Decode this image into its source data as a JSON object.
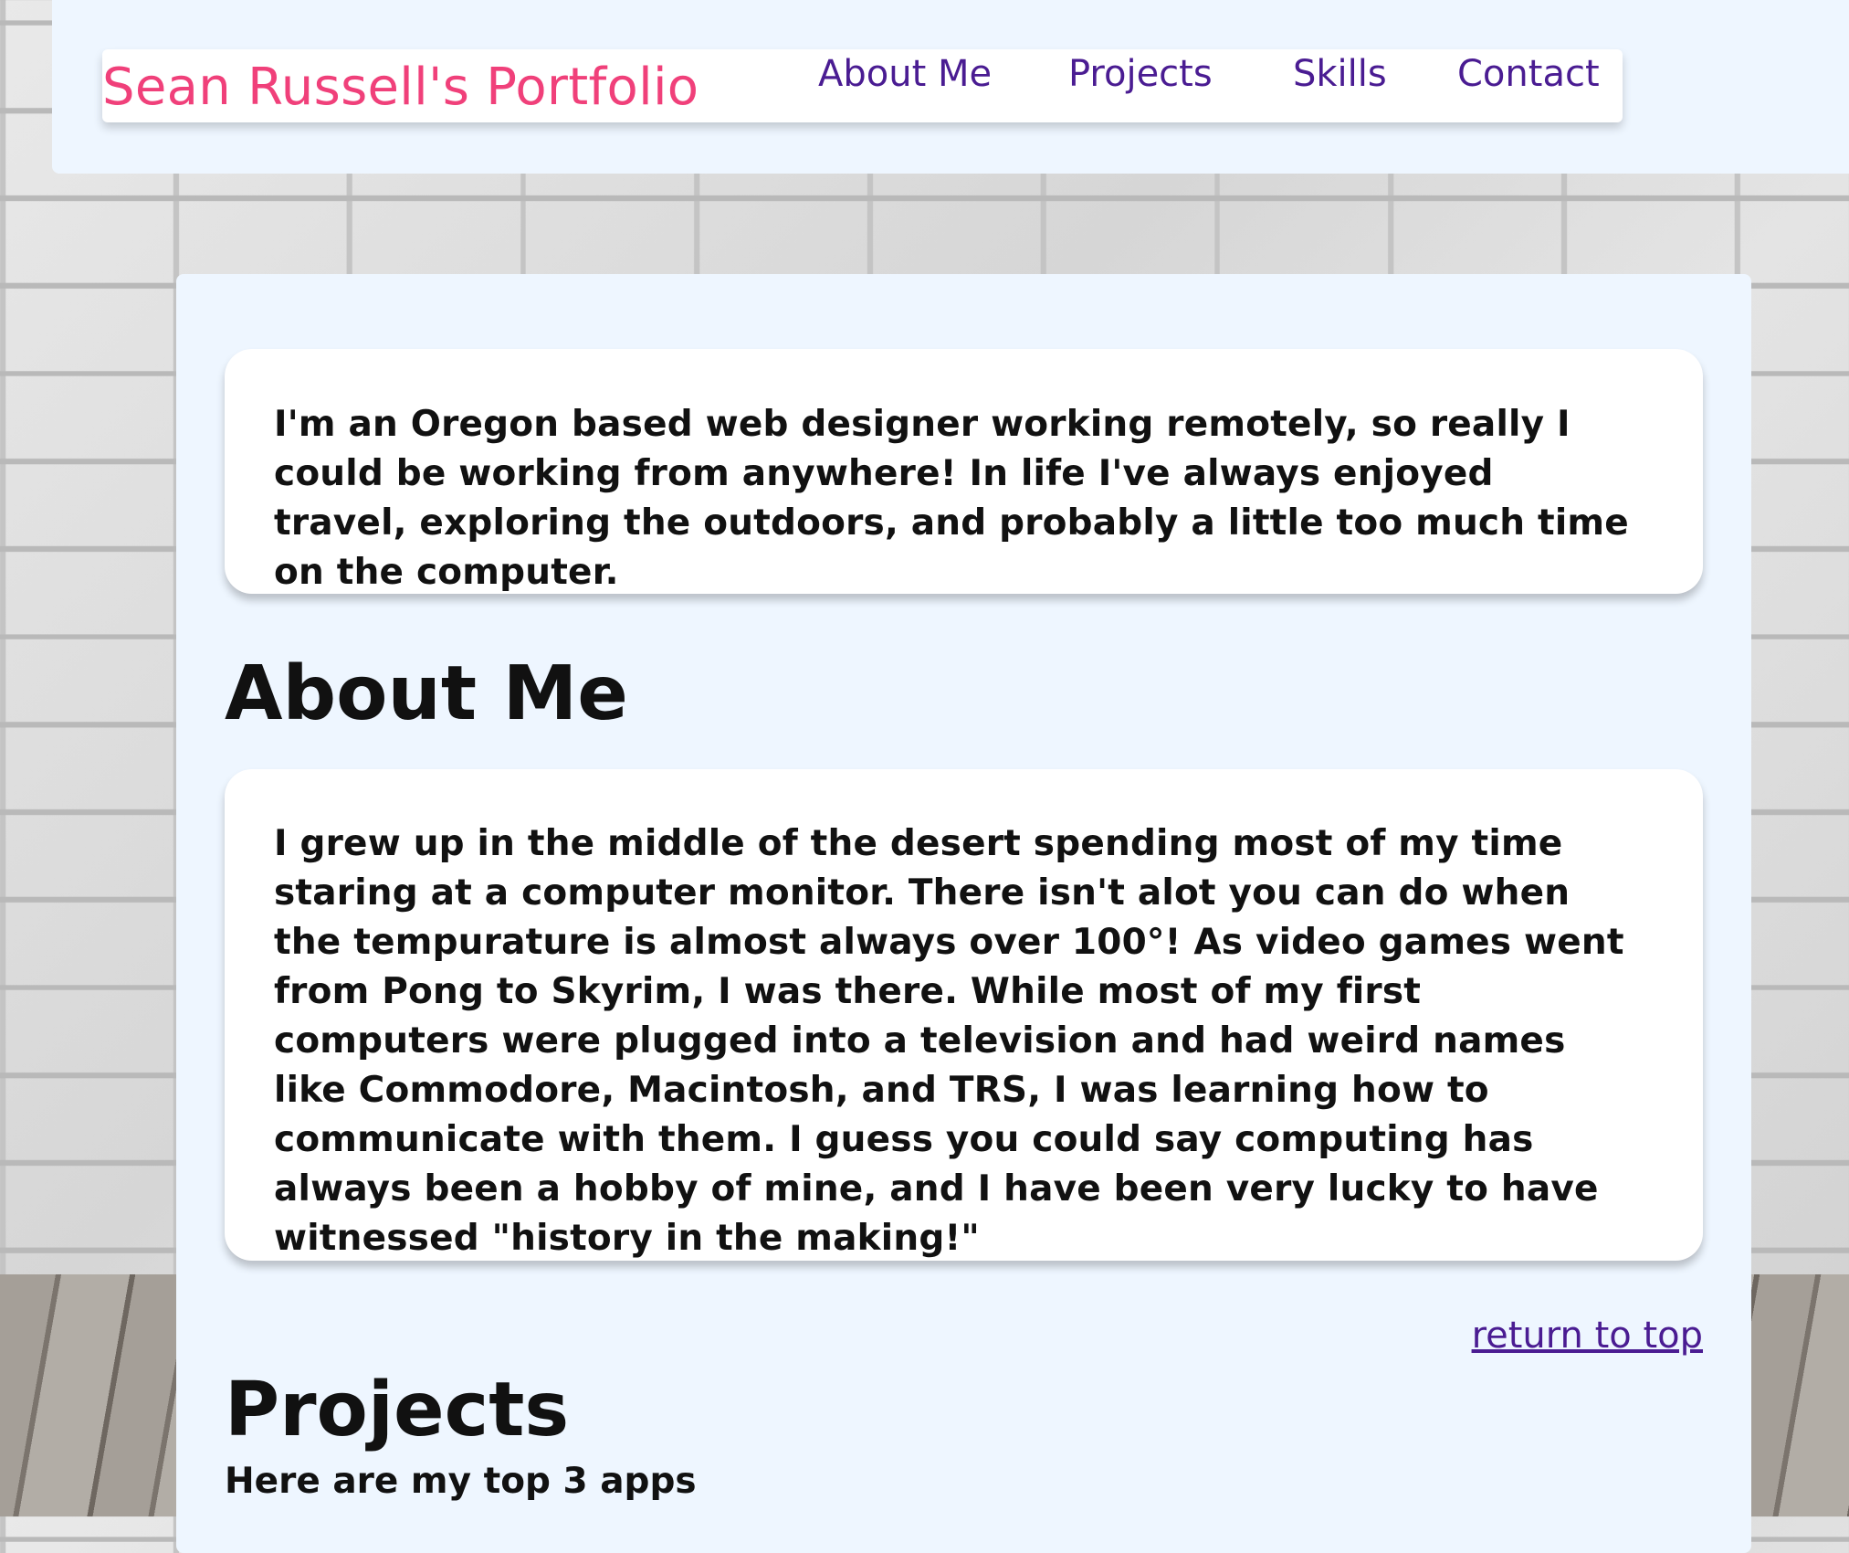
{
  "header": {
    "brand": "Sean Russell's Portfolio",
    "nav": [
      {
        "label": "About Me"
      },
      {
        "label": "Projects"
      },
      {
        "label": "Skills"
      },
      {
        "label": "Contact"
      }
    ]
  },
  "intro": {
    "text": "I'm an Oregon based web designer working remotely, so really I could be working from anywhere! In life I've always enjoyed travel, exploring the outdoors, and probably a little too much time on the computer."
  },
  "about": {
    "heading": "About Me",
    "text": "I grew up in the middle of the desert spending most of my time staring at a computer monitor. There isn't alot you can do when the tempurature is almost always over 100°! As video games went from Pong to Skyrim, I was there. While most of my first computers were plugged into a television and had weird names like Commodore, Macintosh, and TRS, I was learning how to communicate with them. I guess you could say computing has always been a hobby of mine, and I have been very lucky to have witnessed \"history in the making!\""
  },
  "return_link": "return to top",
  "projects": {
    "heading": "Projects",
    "subtitle": "Here are my top 3 apps"
  },
  "colors": {
    "brand": "#f0407a",
    "nav_link": "#4a1c92",
    "panel_bg": "#eef6ff"
  }
}
